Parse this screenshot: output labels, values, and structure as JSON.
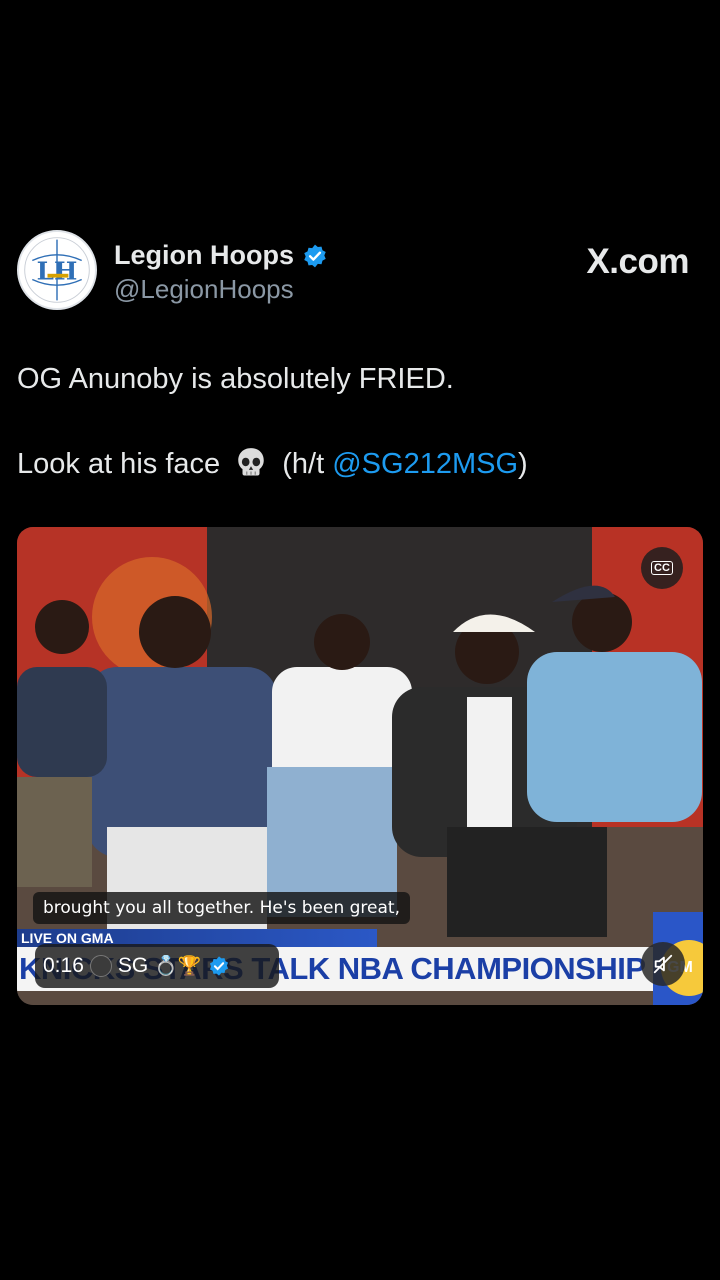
{
  "author": {
    "name": "Legion Hoops",
    "handle": "@LegionHoops",
    "avatar_text": "LH",
    "verified": true
  },
  "brand": {
    "label": "X.com"
  },
  "tweet": {
    "line1": "OG Anunoby is absolutely FRIED.",
    "line2_prefix": "Look at his face",
    "line2_mid": "(h/t ",
    "mention": "@SG212MSG",
    "line2_suffix": ")"
  },
  "video": {
    "caption": "brought you all together. He's been great,",
    "live_label": "LIVE ON GMA",
    "lower_third": "KNICKS STARS TALK NBA CHAMPIONSHIP",
    "gma_logo_text": "GM",
    "cc_label": "CC",
    "timestamp": "0:16",
    "channel_name": "SG",
    "channel_emojis": "💍🏆",
    "muted": true
  },
  "colors": {
    "background": "#000000",
    "text": "#e7e9ea",
    "secondary_text": "#8b98a5",
    "link": "#1d9bf0",
    "verified": "#1d9bf0"
  }
}
